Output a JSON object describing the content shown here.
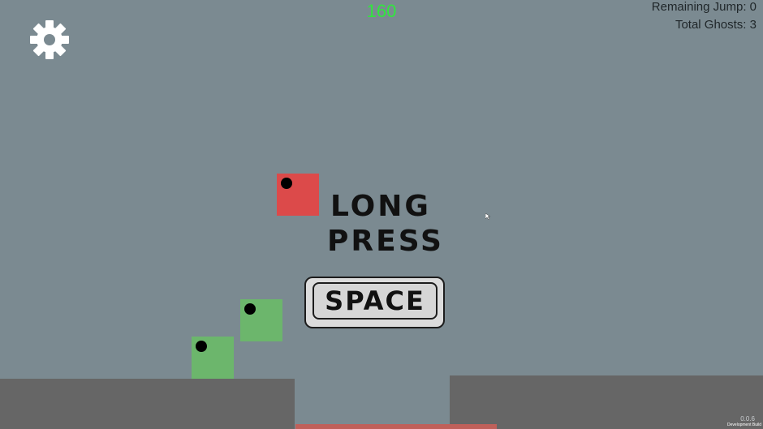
{
  "hud": {
    "score": "160",
    "remaining_jump": "Remaining Jump: 0",
    "total_ghosts": "Total Ghosts: 3"
  },
  "settings_icon": "gear-icon",
  "tutorial": {
    "line1": "LONG",
    "line2": "PRESS",
    "key_label": "SPACE"
  },
  "footer": {
    "version": "0.0.6",
    "build_label": "Development Build"
  },
  "colors": {
    "background": "#7b8a91",
    "score": "#31e63e",
    "player": "#dc4a4a",
    "ghost": "#6cb66c",
    "platform": "#666666",
    "hazard": "#c0605a"
  }
}
